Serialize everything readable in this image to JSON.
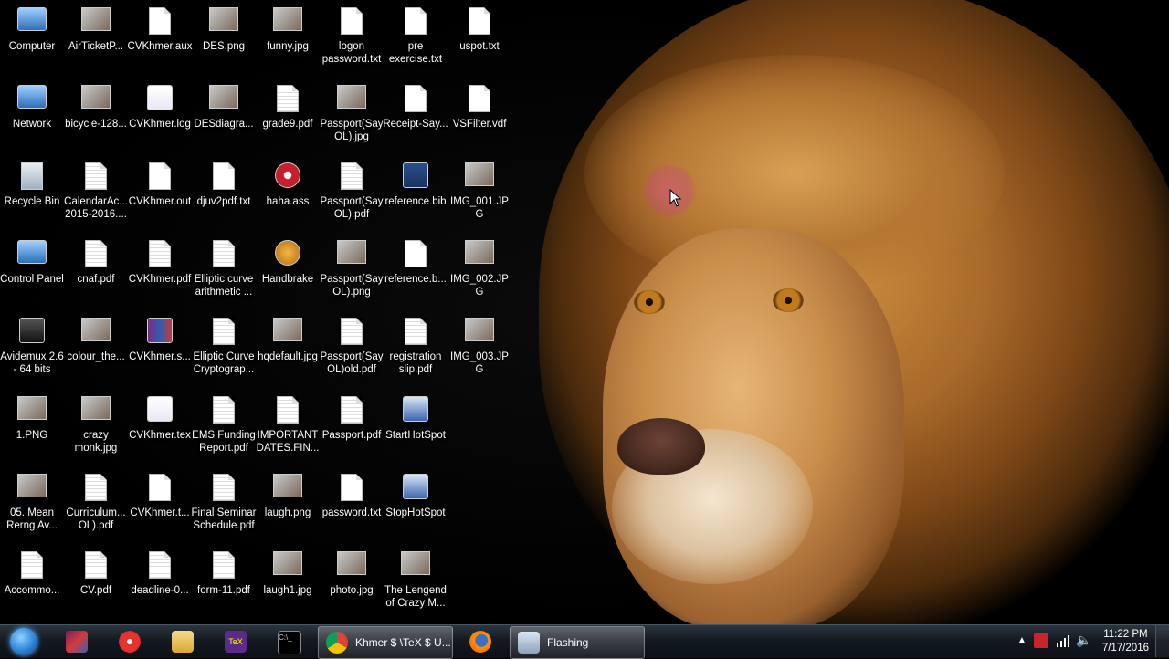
{
  "desktop": {
    "icons": [
      {
        "label": "Computer",
        "kind": "computer-icon"
      },
      {
        "label": "AirTicketP...",
        "kind": "image-file-icon"
      },
      {
        "label": "CVKhmer.aux",
        "kind": "document-icon"
      },
      {
        "label": "DES.png",
        "kind": "image-file-icon"
      },
      {
        "label": "funny.jpg",
        "kind": "image-file-icon"
      },
      {
        "label": "logon password.txt",
        "kind": "text-file-icon"
      },
      {
        "label": "pre exercise.txt",
        "kind": "text-file-icon"
      },
      {
        "label": "uspot.txt",
        "kind": "text-file-icon"
      },
      {
        "label": "Network",
        "kind": "network-icon"
      },
      {
        "label": "bicycle-128...",
        "kind": "image-file-icon"
      },
      {
        "label": "CVKhmer.log",
        "kind": "log-file-icon"
      },
      {
        "label": "DESdiagra...",
        "kind": "image-file-icon"
      },
      {
        "label": "grade9.pdf",
        "kind": "pdf-file-icon"
      },
      {
        "label": "Passport(Say OL).jpg",
        "kind": "image-file-icon"
      },
      {
        "label": "Receipt-Say...",
        "kind": "document-icon"
      },
      {
        "label": "VSFilter.vdf",
        "kind": "document-icon"
      },
      {
        "label": "Recycle Bin",
        "kind": "recycle-bin-icon"
      },
      {
        "label": "CalendarAc... 2015-2016....",
        "kind": "pdf-file-icon"
      },
      {
        "label": "CVKhmer.out",
        "kind": "document-icon"
      },
      {
        "label": "djuv2pdf.txt",
        "kind": "text-file-icon"
      },
      {
        "label": "haha.ass",
        "kind": "media-file-icon"
      },
      {
        "label": "Passport(Say OL).pdf",
        "kind": "pdf-file-icon"
      },
      {
        "label": "reference.bib",
        "kind": "bib-file-icon"
      },
      {
        "label": "IMG_001.JPG",
        "kind": "image-file-icon"
      },
      {
        "label": "Control Panel",
        "kind": "control-panel-icon"
      },
      {
        "label": "cnaf.pdf",
        "kind": "pdf-file-icon"
      },
      {
        "label": "CVKhmer.pdf",
        "kind": "pdf-file-icon"
      },
      {
        "label": "Elliptic curve arithmetic ...",
        "kind": "pdf-file-icon"
      },
      {
        "label": "Handbrake",
        "kind": "handbrake-icon"
      },
      {
        "label": "Passport(Say OL).png",
        "kind": "image-file-icon"
      },
      {
        "label": "reference.b...",
        "kind": "document-icon"
      },
      {
        "label": "IMG_002.JPG",
        "kind": "image-file-icon"
      },
      {
        "label": "Avidemux 2.6 - 64 bits",
        "kind": "avidemux-icon"
      },
      {
        "label": "colour_the...",
        "kind": "image-file-icon"
      },
      {
        "label": "CVKhmer.s...",
        "kind": "archive-icon"
      },
      {
        "label": "Elliptic Curve Cryptograp...",
        "kind": "pdf-file-icon"
      },
      {
        "label": "hqdefault.jpg",
        "kind": "image-file-icon"
      },
      {
        "label": "Passport(Say OL)old.pdf",
        "kind": "pdf-file-icon"
      },
      {
        "label": "registration slip.pdf",
        "kind": "pdf-file-icon"
      },
      {
        "label": "IMG_003.JPG",
        "kind": "image-file-icon"
      },
      {
        "label": "1.PNG",
        "kind": "image-file-icon"
      },
      {
        "label": "crazy monk.jpg",
        "kind": "image-file-icon"
      },
      {
        "label": "CVKhmer.tex",
        "kind": "tex-file-icon"
      },
      {
        "label": "EMS Funding Report.pdf",
        "kind": "pdf-file-icon"
      },
      {
        "label": "IMPORTANT DATES.FIN...",
        "kind": "pdf-file-icon"
      },
      {
        "label": "Passport.pdf",
        "kind": "pdf-file-icon"
      },
      {
        "label": "StartHotSpot",
        "kind": "hotspot-icon"
      },
      {
        "label": "05. Mean Rerng Av...",
        "kind": "video-file-icon"
      },
      {
        "label": "Curriculum... OL).pdf",
        "kind": "pdf-file-icon"
      },
      {
        "label": "CVKhmer.t...",
        "kind": "document-icon"
      },
      {
        "label": "Final Seminar Schedule.pdf",
        "kind": "pdf-file-icon"
      },
      {
        "label": "laugh.png",
        "kind": "image-file-icon"
      },
      {
        "label": "password.txt",
        "kind": "text-file-icon"
      },
      {
        "label": "StopHotSpot",
        "kind": "hotspot-icon"
      },
      {
        "label": "Accommo...",
        "kind": "pdf-file-icon"
      },
      {
        "label": "CV.pdf",
        "kind": "pdf-file-icon"
      },
      {
        "label": "deadline-0...",
        "kind": "pdf-file-icon"
      },
      {
        "label": "form-11.pdf",
        "kind": "pdf-file-icon"
      },
      {
        "label": "laugh1.jpg",
        "kind": "image-file-icon"
      },
      {
        "label": "photo.jpg",
        "kind": "image-file-icon"
      },
      {
        "label": "The Lengend of Crazy M...",
        "kind": "image-file-icon"
      }
    ]
  },
  "taskbar": {
    "pinned": [
      {
        "name": "start-button",
        "icon": "windows-logo-icon"
      },
      {
        "name": "winrar-taskbar",
        "icon": "winrar-icon"
      },
      {
        "name": "app-red-taskbar",
        "icon": "red-app-icon"
      },
      {
        "name": "explorer-taskbar",
        "icon": "folder-icon"
      },
      {
        "name": "tex-taskbar",
        "icon": "tex-icon"
      },
      {
        "name": "cmd-taskbar",
        "icon": "command-prompt-icon"
      }
    ],
    "chrome_label": "Khmer $ \\TeX $ U...",
    "firefox_icon": "firefox-icon",
    "flashing_label": "Flashing",
    "tray_icons": [
      "show-hidden-icons-icon",
      "avira-icon",
      "network-signal-icon",
      "volume-icon"
    ],
    "clock_time": "11:22 PM",
    "clock_date": "7/17/2016"
  }
}
